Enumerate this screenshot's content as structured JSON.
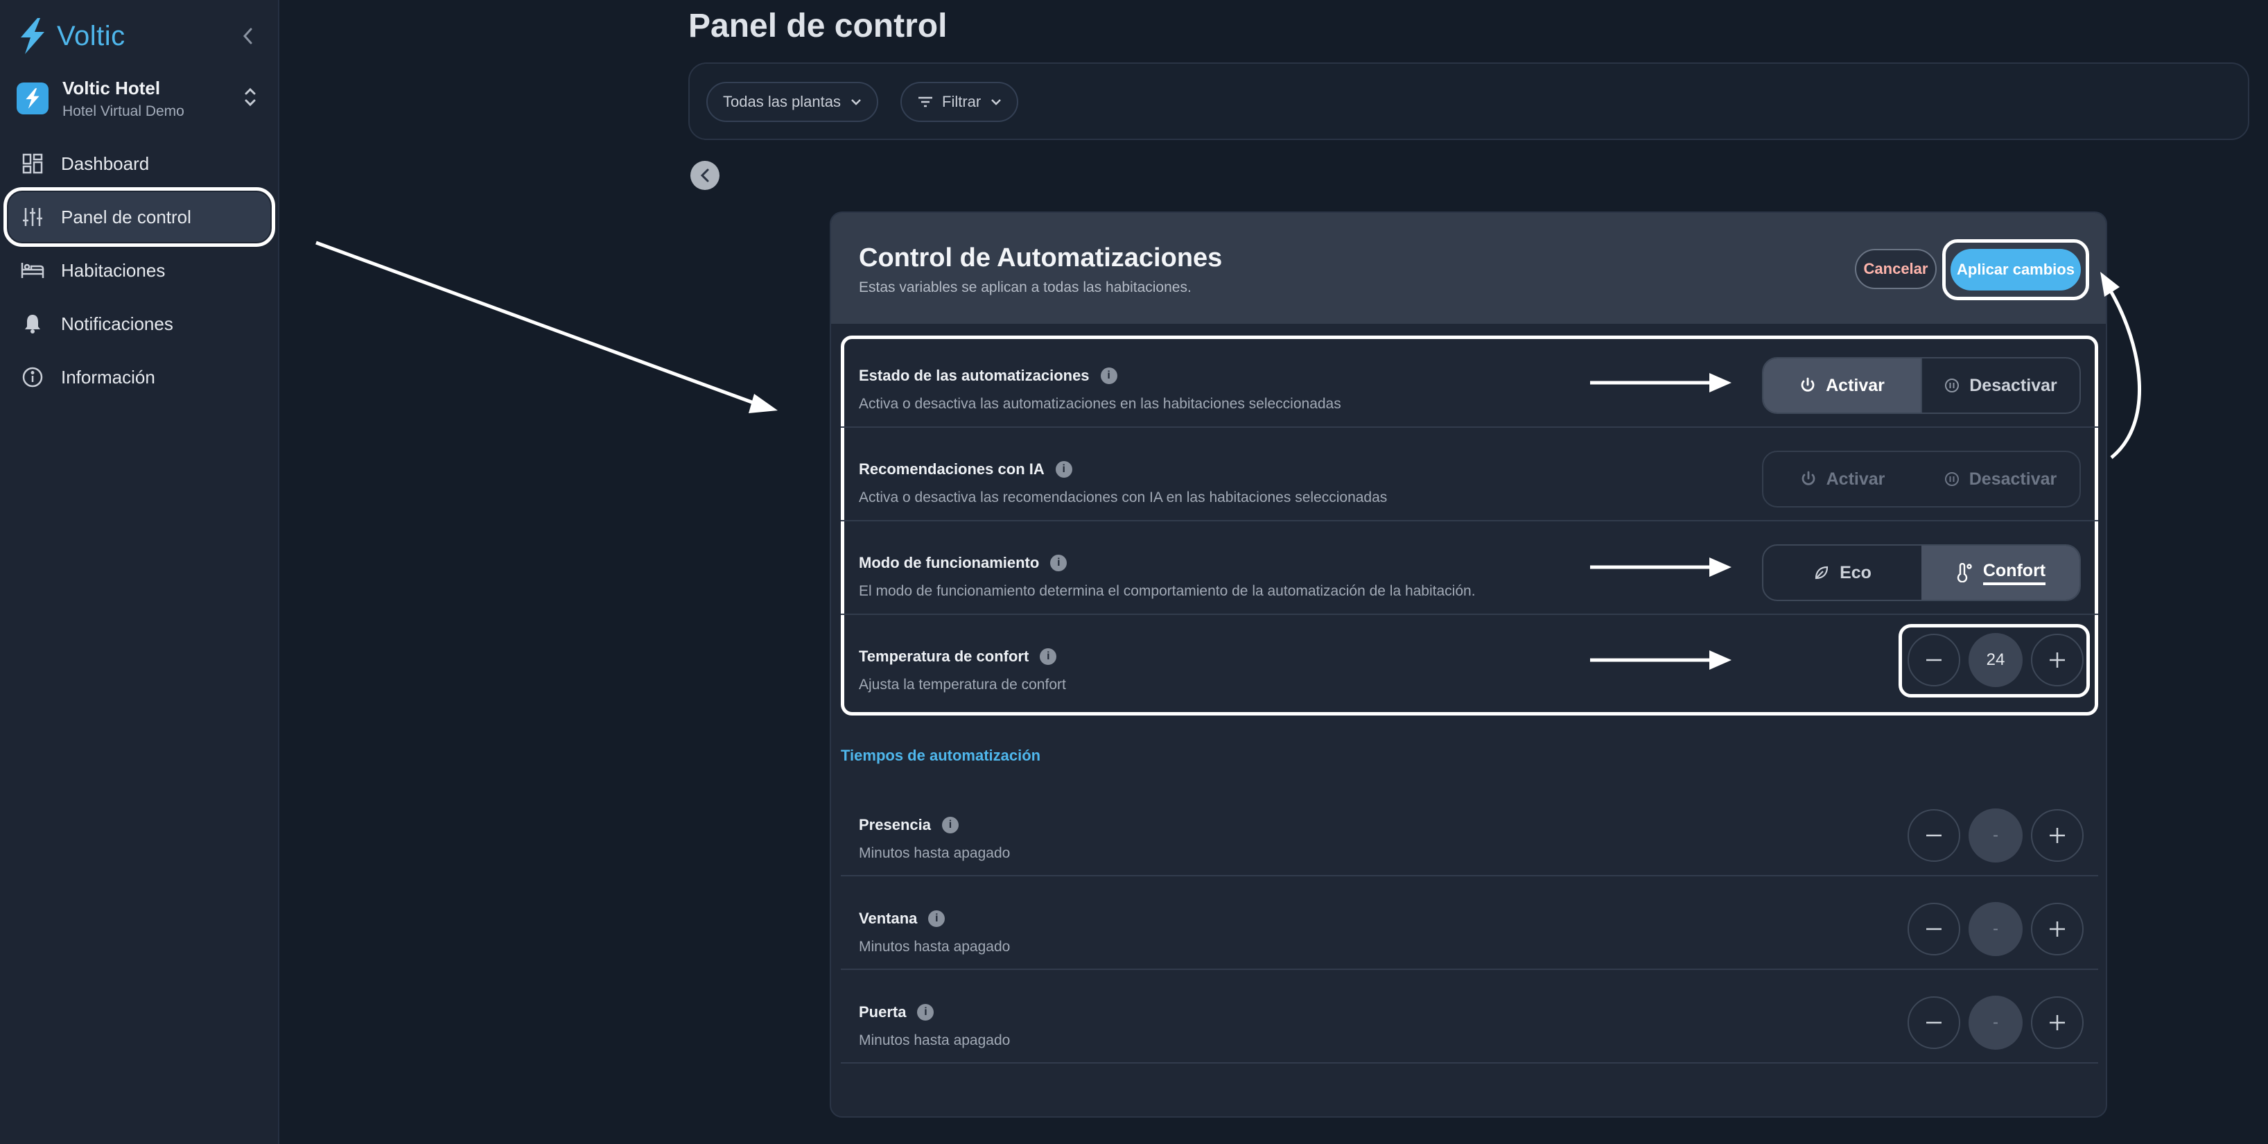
{
  "brand": {
    "name": "Voltic"
  },
  "hotel": {
    "name": "Voltic Hotel",
    "subtitle": "Hotel Virtual Demo"
  },
  "sidebar": {
    "items": [
      {
        "label": "Dashboard",
        "icon": "grid-icon",
        "active": false
      },
      {
        "label": "Panel de control",
        "icon": "sliders-icon",
        "active": true
      },
      {
        "label": "Habitaciones",
        "icon": "bed-icon",
        "active": false
      },
      {
        "label": "Notificaciones",
        "icon": "bell-icon",
        "active": false
      },
      {
        "label": "Información",
        "icon": "info-icon",
        "active": false
      }
    ]
  },
  "page": {
    "title": "Panel de control"
  },
  "filters": {
    "floors": "Todas las plantas",
    "filter": "Filtrar"
  },
  "panel": {
    "title": "Control de Automatizaciones",
    "subtitle": "Estas variables se aplican a todas las habitaciones.",
    "cancel": "Cancelar",
    "apply": "Aplicar cambios"
  },
  "settings": [
    {
      "label": "Estado de las automatizaciones",
      "desc": "Activa o desactiva las automatizaciones en las habitaciones seleccionadas",
      "options": [
        "Activar",
        "Desactivar"
      ],
      "selected": "Activar"
    },
    {
      "label": "Recomendaciones con IA",
      "desc": "Activa o desactiva las recomendaciones con IA en las habitaciones seleccionadas",
      "options": [
        "Activar",
        "Desactivar"
      ],
      "selected": null
    },
    {
      "label": "Modo de funcionamiento",
      "desc": "El modo de funcionamiento determina el comportamiento de la automatización de la habitación.",
      "options": [
        "Eco",
        "Confort"
      ],
      "selected": "Confort"
    },
    {
      "label": "Temperatura de confort",
      "desc": "Ajusta la temperatura de confort",
      "value": "24"
    }
  ],
  "timers": {
    "title": "Tiempos de automatización",
    "items": [
      {
        "label": "Presencia",
        "desc": "Minutos hasta apagado",
        "value": "-"
      },
      {
        "label": "Ventana",
        "desc": "Minutos hasta apagado",
        "value": "-"
      },
      {
        "label": "Puerta",
        "desc": "Minutos hasta apagado",
        "value": "-"
      }
    ]
  },
  "colors": {
    "accent": "#4fb7ec",
    "apply": "#4bb4ee",
    "cancel_text": "#ffb5ac",
    "background": "#141c28",
    "panel": "#1f2735"
  }
}
